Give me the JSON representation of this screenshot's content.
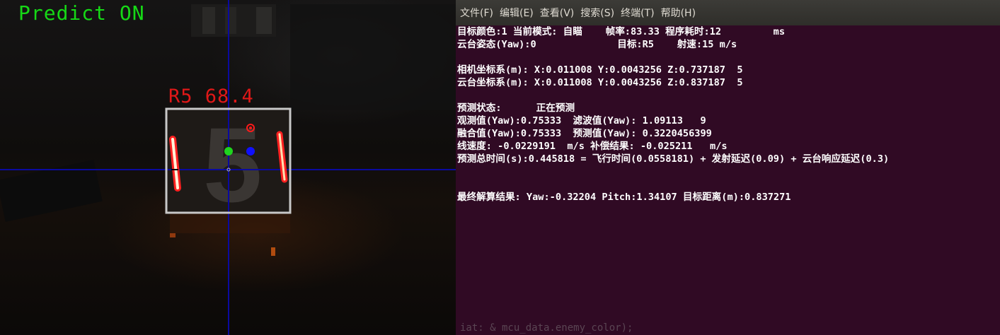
{
  "camera": {
    "predict_label": "Predict ON",
    "target_label": "R5 68.4",
    "colors": {
      "crosshair": "#0a0aa0",
      "box": "#c8c8c8",
      "light_bar": "#ff2020",
      "predict_text": "#16d916",
      "target_text": "#e01818"
    }
  },
  "terminal": {
    "menu": [
      {
        "label": "文件(F)"
      },
      {
        "label": "编辑(E)"
      },
      {
        "label": "查看(V)"
      },
      {
        "label": "搜索(S)"
      },
      {
        "label": "终端(T)"
      },
      {
        "label": "帮助(H)"
      }
    ],
    "lines": [
      "目标颜色:1 当前模式: 自瞄    帧率:83.33 程序耗时:12         ms",
      "云台姿态(Yaw):0              目标:R5    射速:15 m/s",
      "",
      "相机坐标系(m): X:0.011008 Y:0.0043256 Z:0.737187  5",
      "云台坐标系(m): X:0.011008 Y:0.0043256 Z:0.837187  5",
      "",
      "预测状态:      正在预测",
      "观测值(Yaw):0.75333  滤波值(Yaw): 1.09113   9",
      "融合值(Yaw):0.75333  预测值(Yaw): 0.3220456399",
      "线速度: -0.0229191  m/s 补偿结果: -0.025211   m/s",
      "预测总时间(s):0.445818 = 飞行时间(0.0558181) + 发射延迟(0.09) + 云台响应延迟(0.3)",
      "",
      "",
      "最终解算结果: Yaw:-0.32204 Pitch:1.34107 目标距离(m):0.837271"
    ],
    "background_text": "iat: & mcu_data.enemy_color);",
    "colors": {
      "background": "#300a24",
      "menubar": "#3c3b37",
      "text": "#ffffff"
    }
  }
}
